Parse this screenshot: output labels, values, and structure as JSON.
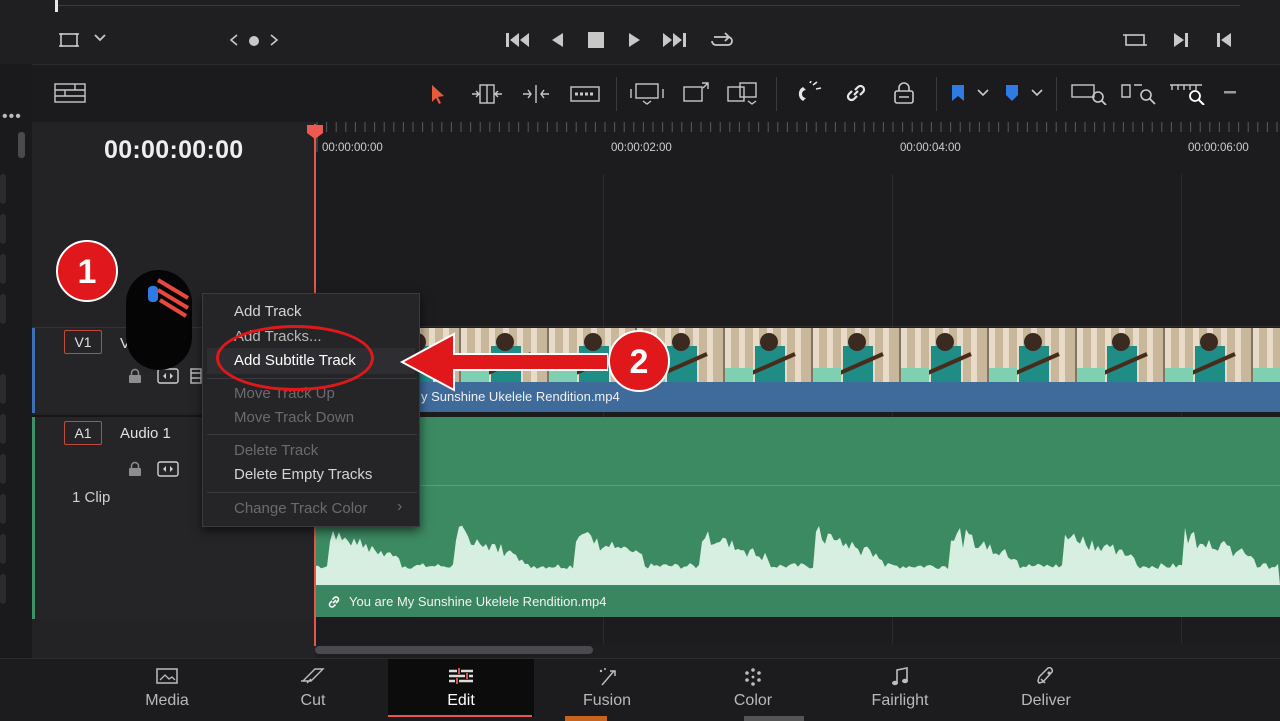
{
  "transport": {
    "icons": [
      "viewer-mode-icon",
      "chevron-down-icon",
      "chevron-left-icon",
      "dot-icon",
      "chevron-right-icon",
      "skip-back-icon",
      "play-reverse-icon",
      "stop-icon",
      "play-icon",
      "skip-forward-icon",
      "loop-icon",
      "loop-range-icon",
      "jump-end-icon",
      "jump-start-icon"
    ]
  },
  "timeline": {
    "timecode": "00:00:00:00",
    "ruler_labels": [
      "00:00:00:00",
      "00:00:02:00",
      "00:00:04:00",
      "00:00:06:00"
    ]
  },
  "tracks": {
    "video": {
      "id": "V1",
      "name": "V",
      "clip_name": "y Sunshine Ukelele Rendition.mp4"
    },
    "audio": {
      "id": "A1",
      "name": "Audio 1",
      "clip_count": "1 Clip",
      "clip_name": "You are My Sunshine Ukelele Rendition.mp4"
    }
  },
  "context_menu": {
    "add_track": "Add Track",
    "add_tracks": "Add Tracks...",
    "add_subtitle_track": "Add Subtitle Track",
    "move_track_up": "Move Track Up",
    "move_track_down": "Move Track Down",
    "delete_track": "Delete Track",
    "delete_empty_tracks": "Delete Empty Tracks",
    "change_track_color": "Change Track Color",
    "submenu_arrow": "›"
  },
  "annotations": {
    "step1": "1",
    "step2": "2",
    "highlight_color": "#e0181c"
  },
  "pages": [
    {
      "label": "Media",
      "icon": "media-icon"
    },
    {
      "label": "Cut",
      "icon": "cut-icon"
    },
    {
      "label": "Edit",
      "icon": "edit-icon",
      "active": true
    },
    {
      "label": "Fusion",
      "icon": "fusion-icon"
    },
    {
      "label": "Color",
      "icon": "color-icon"
    },
    {
      "label": "Fairlight",
      "icon": "fairlight-icon"
    },
    {
      "label": "Deliver",
      "icon": "deliver-icon"
    }
  ],
  "colors": {
    "video_clip": "#3f6b9b",
    "audio_clip": "#3c8a62",
    "playhead": "#e8554a",
    "accent_blue": "#2f7be6"
  }
}
